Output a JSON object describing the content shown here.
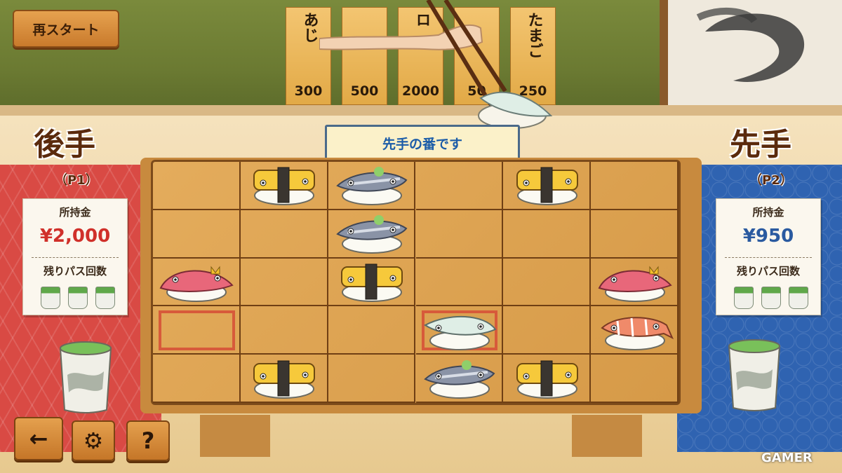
{
  "header": {
    "restart_label": "再スタート"
  },
  "menu_tags": [
    {
      "name": "あじ",
      "price": "300"
    },
    {
      "name": "",
      "price": "500"
    },
    {
      "name": "ロ",
      "price": "2000"
    },
    {
      "name": "",
      "price": "50"
    },
    {
      "name": "たまご",
      "price": "250"
    }
  ],
  "turn_banner": "先手の番です",
  "left_player": {
    "label": "後手",
    "id": "（P1）",
    "money_label": "所持金",
    "money": "¥2,000",
    "pass_label": "残りパス回数",
    "passes_remaining": 3
  },
  "right_player": {
    "label": "先手",
    "id": "（P2）",
    "money_label": "所持金",
    "money": "¥950",
    "pass_label": "残りパス回数",
    "passes_remaining": 3
  },
  "board": {
    "rows": 5,
    "cols": 6,
    "pieces": [
      {
        "row": 0,
        "col": 1,
        "type": "tamago"
      },
      {
        "row": 0,
        "col": 2,
        "type": "aji"
      },
      {
        "row": 0,
        "col": 4,
        "type": "tamago"
      },
      {
        "row": 1,
        "col": 2,
        "type": "aji"
      },
      {
        "row": 2,
        "col": 0,
        "type": "otoro"
      },
      {
        "row": 2,
        "col": 2,
        "type": "tamago"
      },
      {
        "row": 2,
        "col": 5,
        "type": "otoro"
      },
      {
        "row": 3,
        "col": 3,
        "type": "ika"
      },
      {
        "row": 3,
        "col": 5,
        "type": "ebi"
      },
      {
        "row": 4,
        "col": 1,
        "type": "tamago"
      },
      {
        "row": 4,
        "col": 3,
        "type": "aji"
      },
      {
        "row": 4,
        "col": 4,
        "type": "tamago"
      }
    ],
    "highlighted": [
      {
        "row": 3,
        "col": 0
      },
      {
        "row": 3,
        "col": 3
      }
    ]
  },
  "buttons": {
    "back_icon": "←",
    "settings_icon": "⚙",
    "help_label": "?"
  },
  "watermark": "GAMER",
  "colors": {
    "left_cloth": "#d94a44",
    "right_cloth": "#2f63b1",
    "money_left": "#d0302a",
    "money_right": "#2a5aa0",
    "turn_text": "#1b5ca8"
  }
}
